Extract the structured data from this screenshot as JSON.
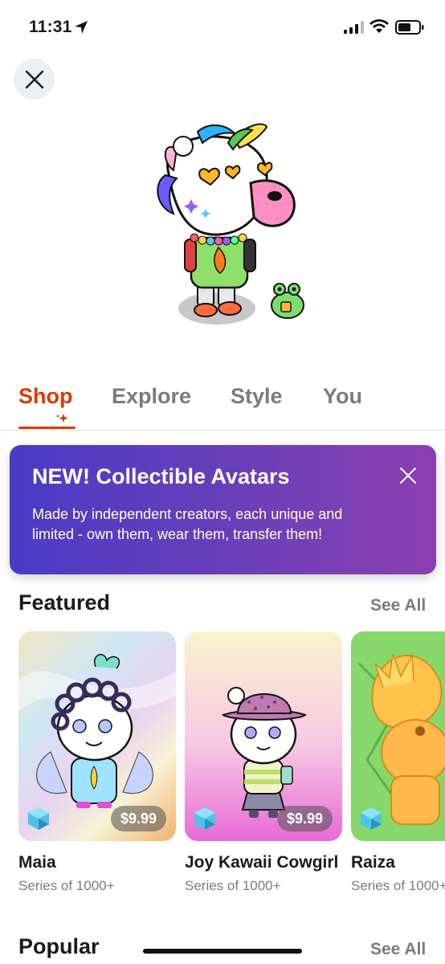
{
  "status_bar": {
    "time": "11:31"
  },
  "tabs": [
    {
      "label": "Shop",
      "active": true
    },
    {
      "label": "Explore",
      "active": false
    },
    {
      "label": "Style",
      "active": false
    },
    {
      "label": "You",
      "active": false
    }
  ],
  "banner": {
    "title": "NEW! Collectible Avatars",
    "body": "Made by independent creators, each unique and limited - own them, wear them, transfer them!"
  },
  "featured": {
    "title": "Featured",
    "see_all": "See All",
    "items": [
      {
        "name": "Maia",
        "series": "Series of 1000+",
        "price": "$9.99"
      },
      {
        "name": "Joy Kawaii Cowgirl",
        "series": "Series of 1000+",
        "price": "$9.99"
      },
      {
        "name": "Raiza",
        "series": "Series of 1000+"
      }
    ]
  },
  "popular": {
    "title": "Popular",
    "see_all": "See All"
  },
  "colors": {
    "accent": "#d93a00",
    "banner_start": "#4a3bc6",
    "banner_end": "#8b3fb0",
    "muted": "#787c7e"
  }
}
